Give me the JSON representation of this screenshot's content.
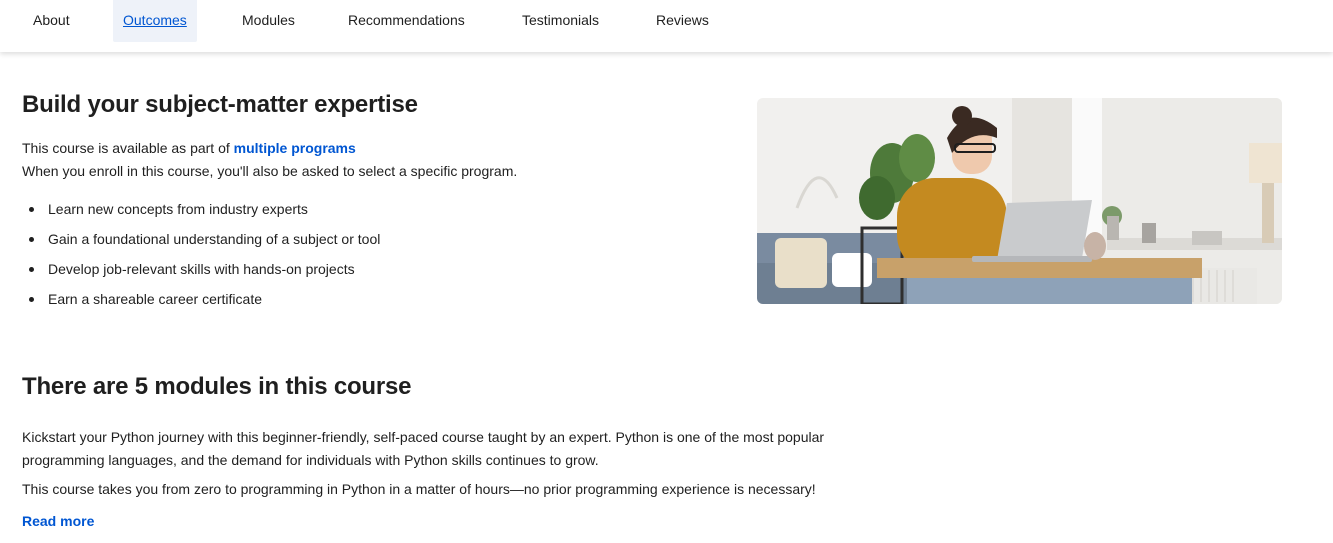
{
  "nav": {
    "tabs": [
      {
        "label": "About"
      },
      {
        "label": "Outcomes",
        "active": true
      },
      {
        "label": "Modules"
      },
      {
        "label": "Recommendations"
      },
      {
        "label": "Testimonials"
      },
      {
        "label": "Reviews"
      }
    ]
  },
  "outcomes": {
    "title": "Build your subject-matter expertise",
    "programs_prefix": "This course is available as part of",
    "programs_link": "multiple programs",
    "enroll_note": "When you enroll in this course, you'll also be asked to select a specific program.",
    "bullets": [
      "Learn new concepts from industry experts",
      "Gain a foundational understanding of a subject or tool",
      "Develop job-relevant skills with hands-on projects",
      "Earn a shareable career certificate"
    ]
  },
  "modules": {
    "title": "There are 5 modules in this course",
    "description_line1": "Kickstart your Python journey with this beginner-friendly, self-paced course taught by an expert. Python is one of the most popular",
    "description_line2": "programming languages, and the demand for individuals with Python skills continues to grow.",
    "description_line3": "This course takes you from zero to programming in Python in a matter of hours—no prior programming experience is necessary!",
    "read_more": "Read more"
  },
  "colors": {
    "link": "#0056d2",
    "active_tab_bg": "#eef2f9",
    "text": "#1f1f1f"
  }
}
